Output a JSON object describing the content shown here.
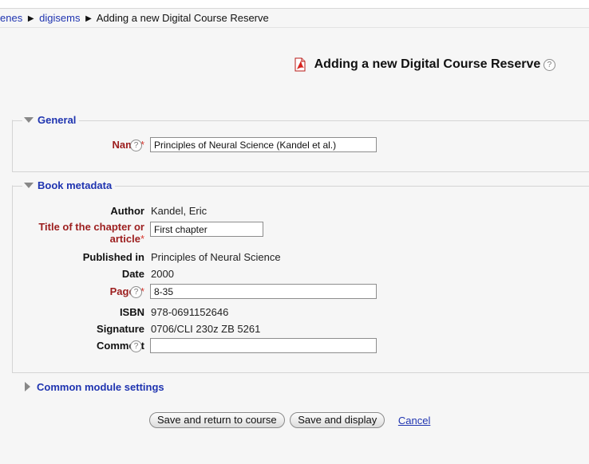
{
  "breadcrumb": {
    "items": [
      "enes",
      "digisems"
    ],
    "current": "Adding a new Digital Course Reserve"
  },
  "heading": {
    "title": "Adding a new Digital Course Reserve",
    "help_glyph": "?"
  },
  "general": {
    "legend": "General",
    "name_label": "Name",
    "name_value": "Principles of Neural Science (Kandel et al.)"
  },
  "book_metadata": {
    "legend": "Book metadata",
    "author_label": "Author",
    "author_value": "Kandel, Eric",
    "chapter_label_1": "Title of the chapter or",
    "chapter_label_2": "article",
    "chapter_value": "First chapter",
    "published_label": "Published in",
    "published_value": "Principles of Neural Science",
    "date_label": "Date",
    "date_value": "2000",
    "pages_label": "Pages",
    "pages_value": "8-35",
    "isbn_label": "ISBN",
    "isbn_value": "978-0691152646",
    "signature_label": "Signature",
    "signature_value": "0706/CLI 230z ZB 5261",
    "comment_label": "Comment",
    "comment_value": ""
  },
  "common_settings": {
    "label": "Common module settings"
  },
  "actions": {
    "save_return": "Save and return to course",
    "save_display": "Save and display",
    "cancel": "Cancel"
  },
  "required_marker": "*",
  "colors": {
    "link": "#1f34b0",
    "required_label": "#9c1e1e",
    "required_star": "#d7372f",
    "pdf_icon": "#d8241f"
  },
  "icons": [
    "help-icon",
    "pdf-icon",
    "expanded-triangle-icon",
    "collapsed-triangle-icon",
    "breadcrumb-separator-icon"
  ]
}
